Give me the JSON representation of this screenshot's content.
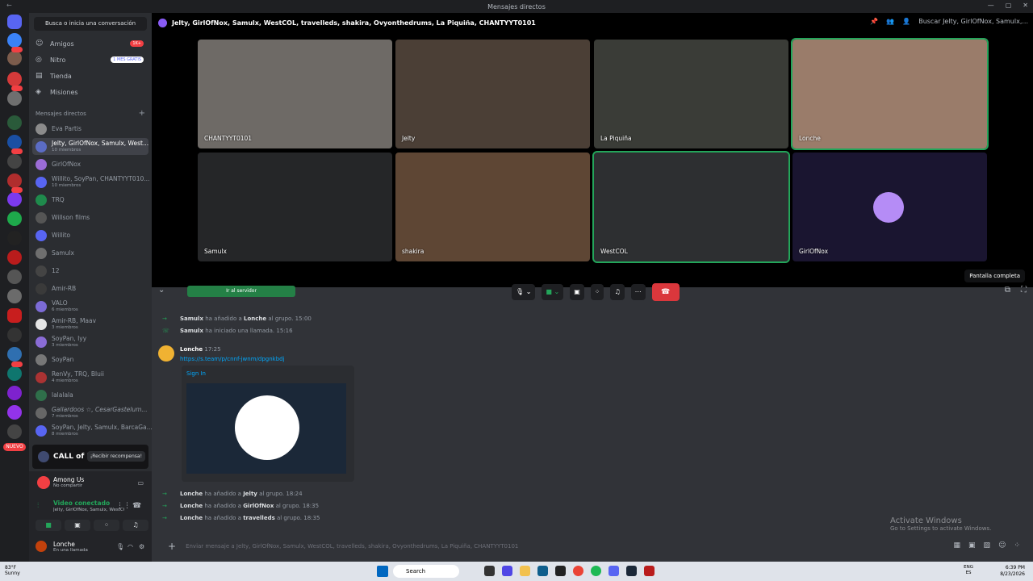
{
  "window": {
    "title": "Mensajes directos"
  },
  "sidebar": {
    "search_placeholder": "Busca o inicia una conversación",
    "nav": [
      {
        "label": "Amigos",
        "badge": "1K+"
      },
      {
        "label": "Nitro",
        "badge": "1 MES GRATIS"
      },
      {
        "label": "Tienda"
      },
      {
        "label": "Misiones"
      }
    ],
    "dm_header": "Mensajes directos",
    "dms": [
      {
        "name": "Eva Partis",
        "sub": ""
      },
      {
        "name": "Jelty, GirlOfNox, Samulx, West...",
        "sub": "10 miembros"
      },
      {
        "name": "GirlOfNox",
        "sub": ""
      },
      {
        "name": "Willito, SoyPan, CHANTYYT010...",
        "sub": "10 miembros"
      },
      {
        "name": "TRQ",
        "sub": ""
      },
      {
        "name": "Willson films",
        "sub": ""
      },
      {
        "name": "Willito",
        "sub": ""
      },
      {
        "name": "Samulx",
        "sub": ""
      },
      {
        "name": "12",
        "sub": ""
      },
      {
        "name": "Amir-RB",
        "sub": ""
      },
      {
        "name": "VALO",
        "sub": "6 miembros"
      },
      {
        "name": "Amir-RB, Maav",
        "sub": "3 miembros"
      },
      {
        "name": "SoyPan, Iyy",
        "sub": "3 miembros"
      },
      {
        "name": "SoyPan",
        "sub": ""
      },
      {
        "name": "RenVy, TRQ, Bluii",
        "sub": "4 miembros"
      },
      {
        "name": "lalalala",
        "sub": ""
      },
      {
        "name": "Gallardoos ☆, CesarGastelum...",
        "sub": "7 miembros"
      },
      {
        "name": "SoyPan, Jelty, Samulx, BarcaGa...",
        "sub": "8 miembros"
      }
    ],
    "promo": {
      "brand": "CALL of DUTY",
      "button": "¡Recibir recompensa!"
    },
    "activity": {
      "game": "Among Us",
      "status": "No compartir"
    },
    "voice": {
      "title": "Video conectado",
      "members": "Jelty, GirlOfNox, Samulx, WestCOL, tra..."
    },
    "user": {
      "name": "Lonche",
      "status": "En una llamada"
    },
    "nuevo": "NUEVO"
  },
  "header": {
    "title": "Jelty, GirlOfNox, Samulx, WestCOL, travelleds, shakira, Ovyonthedrums, La Piquiña, CHANTYYT0101",
    "search": "Buscar Jelty, GirlOfNox, Samulx,..."
  },
  "call": {
    "tiles": [
      {
        "name": "CHANTYYT0101",
        "color": "#6e6a66"
      },
      {
        "name": "Jelty",
        "color": "#4b3f36"
      },
      {
        "name": "La Piquiña",
        "color": "#3a3c37"
      },
      {
        "name": "Lonche",
        "color": "#9a7c6a"
      },
      {
        "name": "Samulx",
        "color": "#252628"
      },
      {
        "name": "shakira",
        "color": "#5e4634"
      },
      {
        "name": "WestCOL",
        "color": "#2d2f31"
      },
      {
        "name": "GirlOfNox",
        "color": ""
      }
    ],
    "tooltip": "Pantalla completa"
  },
  "chat": {
    "server_button": "Ir al servidor",
    "events_top": [
      {
        "actor": "Samulx",
        "text": " ha añadido a ",
        "target": "Lonche",
        "tail": " al grupo.",
        "time": "15:00"
      },
      {
        "actor": "Samulx",
        "text": " ha iniciado una llamada.",
        "target": "",
        "tail": "",
        "time": "15:16"
      }
    ],
    "message": {
      "author": "Lonche",
      "time": "17:25",
      "link": "https://s.team/p/cnnf-jwnm/dpgnkbdj",
      "embed_title": "Sign In"
    },
    "events_bottom": [
      {
        "actor": "Lonche",
        "text": " ha añadido a ",
        "target": "Jelty",
        "tail": " al grupo.",
        "time": "18:24"
      },
      {
        "actor": "Lonche",
        "text": " ha añadido a ",
        "target": "GirlOfNox",
        "tail": " al grupo.",
        "time": "18:35"
      },
      {
        "actor": "Lonche",
        "text": " ha añadido a ",
        "target": "travelleds",
        "tail": " al grupo.",
        "time": "18:35"
      }
    ],
    "input_placeholder": "Enviar mensaje a Jelty, GirlOfNox, Samulx, WestCOL, travelleds, shakira, Ovyonthedrums, La Piquiña, CHANTYYT0101"
  },
  "watermark": {
    "title": "Activate Windows",
    "sub": "Go to Settings to activate Windows."
  },
  "taskbar": {
    "temp": "83°F",
    "weather": "Sunny",
    "search": "Search",
    "lang1": "ENG",
    "lang2": "ES",
    "time": "6:39 PM",
    "date": "8/23/2026"
  }
}
